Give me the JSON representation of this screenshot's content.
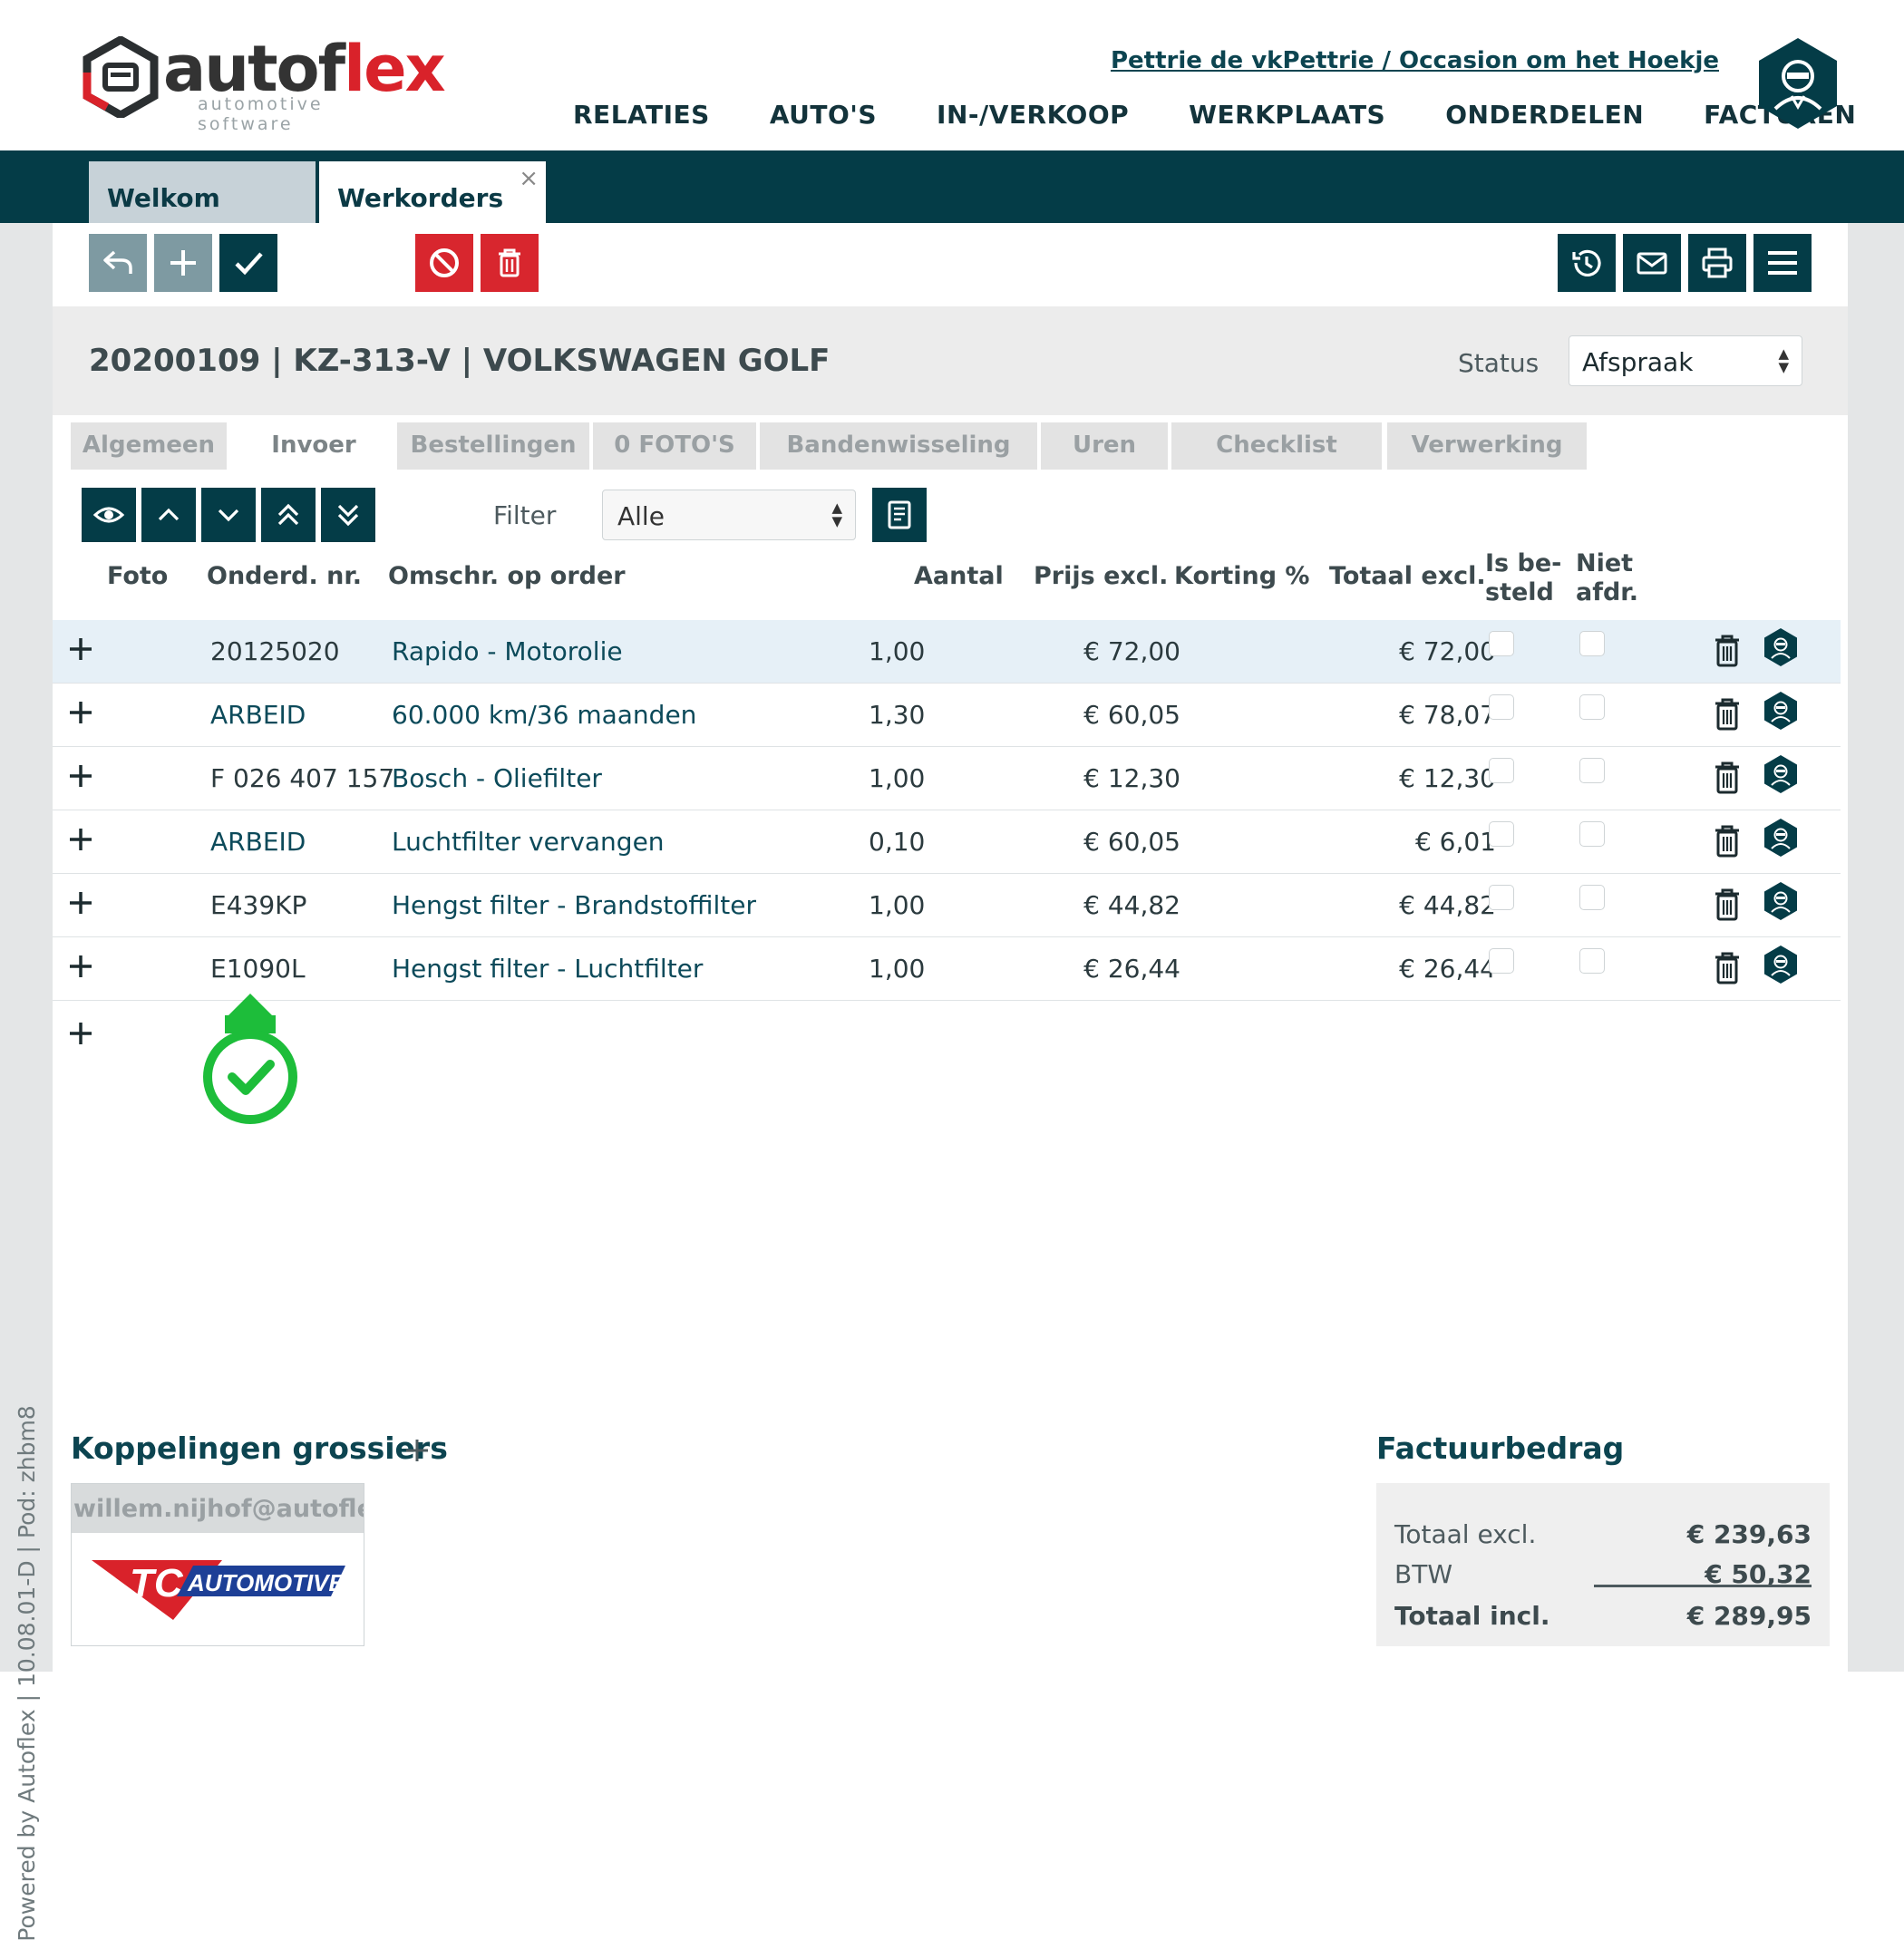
{
  "brand": {
    "name_prefix": "autof",
    "name_accent": "lex",
    "tagline": "automotive software",
    "logo_icon": "autoflex-logo-icon"
  },
  "header": {
    "user_link": "Pettrie de vkPettrie / Occasion om het Hoekje",
    "nav": [
      "RELATIES",
      "AUTO'S",
      "IN-/VERKOOP",
      "WERKPLAATS",
      "ONDERDELEN",
      "FACTUREN"
    ],
    "avatar_icon": "user-avatar-icon"
  },
  "tabs": {
    "welkom": "Welkom",
    "werkorders": "Werkorders",
    "close": "×"
  },
  "toolbar": {
    "left_icons": [
      "undo-icon",
      "plus-icon",
      "check-icon"
    ],
    "danger_icons": [
      "cancel-icon",
      "trash-icon"
    ],
    "right_icons": [
      "history-icon",
      "mail-icon",
      "print-icon",
      "menu-icon"
    ]
  },
  "workorder": {
    "title": "20200109 | KZ-313-V | VOLKSWAGEN GOLF",
    "status_label": "Status",
    "status_value": "Afspraak"
  },
  "section_tabs": [
    "Algemeen",
    "Invoer",
    "Bestellingen",
    "0 FOTO'S",
    "Bandenwisseling",
    "Uren",
    "Checklist",
    "Verwerking"
  ],
  "active_section_tab": "Invoer",
  "filter": {
    "label": "Filter",
    "value": "Alle",
    "icons": [
      "eye-icon",
      "chevron-up-icon",
      "chevron-down-icon",
      "double-chevron-up-icon",
      "double-chevron-down-icon",
      "book-icon"
    ]
  },
  "table": {
    "headers": {
      "foto": "Foto",
      "nr": "Onderd. nr.",
      "desc": "Omschr. op order",
      "qty": "Aantal",
      "price": "Prijs excl.",
      "discount": "Korting %",
      "total": "Totaal excl.",
      "ordered_l1": "Is be-",
      "ordered_l2": "steld",
      "niet_l1": "Niet",
      "niet_l2": "afdr."
    },
    "rows": [
      {
        "nr": "20125020",
        "desc": "Rapido - Motorolie",
        "qty": "1,00",
        "price": "€ 72,00",
        "total": "€ 72,00"
      },
      {
        "nr": "ARBEID",
        "desc": "60.000 km/36 maanden",
        "qty": "1,30",
        "price": "€ 60,05",
        "total": "€ 78,07"
      },
      {
        "nr": "F 026 407 157",
        "desc": "Bosch - Oliefilter",
        "qty": "1,00",
        "price": "€ 12,30",
        "total": "€ 12,30"
      },
      {
        "nr": "ARBEID",
        "desc": "Luchtfilter vervangen",
        "qty": "0,10",
        "price": "€ 60,05",
        "total": "€ 6,01"
      },
      {
        "nr": "E439KP",
        "desc": "Hengst filter - Brandstoffilter",
        "qty": "1,00",
        "price": "€ 44,82",
        "total": "€ 44,82"
      },
      {
        "nr": "E1090L",
        "desc": "Hengst filter - Luchtfilter",
        "qty": "1,00",
        "price": "€ 26,44",
        "total": "€ 26,44"
      }
    ],
    "row_icons": [
      "plus-icon",
      "trash-icon",
      "mechanic-icon"
    ],
    "status_marker_icon": "check-circle-icon"
  },
  "koppelingen": {
    "title": "Koppelingen grossiers",
    "email": "willem.nijhof@autoflex.",
    "supplier_logo_text": "AUTOMOTIVE",
    "supplier_logo_mark": "TC"
  },
  "factuur": {
    "title": "Factuurbedrag",
    "excl_label": "Totaal excl.",
    "excl_value": "€ 239,63",
    "btw_label": "BTW",
    "btw_value": "€ 50,32",
    "incl_label": "Totaal incl.",
    "incl_value": "€ 289,95"
  },
  "footer": {
    "powered": "Powered by Autoflex | 10.08.01-D | Pod: zhbm8"
  },
  "colors": {
    "dark_teal": "#043c47",
    "danger_red": "#d8262e",
    "grey_button": "#7e9aa2",
    "brand_red": "#d9222a",
    "success_green": "#1dbd3a",
    "row_highlight": "#e6f0f7"
  }
}
